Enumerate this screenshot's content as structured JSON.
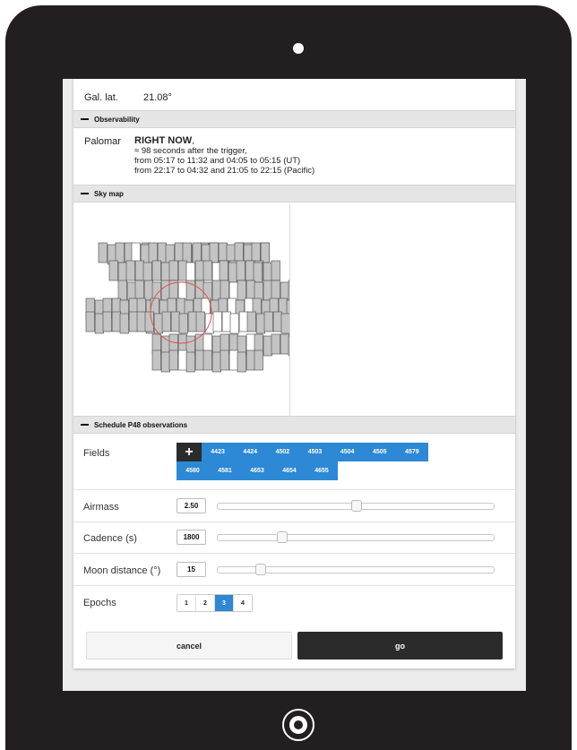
{
  "gal_lat": {
    "label": "Gal. lat.",
    "value": "21.08°"
  },
  "observability": {
    "title": "Observability",
    "site": "Palomar",
    "status": "RIGHT NOW",
    "status_suffix": ",",
    "lines": [
      "≈ 98 seconds after the trigger,",
      "from 05:17 to 11:32 and 04:05 to 05:15 (UT)",
      "from 22:17 to 04:32 and 21:05 to 22:15 (Pacific)"
    ]
  },
  "skymap": {
    "title": "Sky map"
  },
  "schedule": {
    "title": "Schedule P48 observations",
    "fields_label": "Fields",
    "add_symbol": "+",
    "fields": [
      "4423",
      "4424",
      "4502",
      "4503",
      "4504",
      "4505",
      "4579",
      "4580",
      "4581",
      "4653",
      "4654",
      "4655"
    ],
    "airmass_label": "Airmass",
    "airmass_value": "2.50",
    "airmass_fraction": 0.5,
    "cadence_label": "Cadence (s)",
    "cadence_value": "1800",
    "cadence_fraction": 0.22,
    "moon_label": "Moon distance (°)",
    "moon_value": "15",
    "moon_fraction": 0.14,
    "epochs_label": "Epochs",
    "epochs": [
      "1",
      "2",
      "3",
      "4"
    ],
    "epochs_selected": "3",
    "cancel_label": "cancel",
    "go_label": "go"
  },
  "colors": {
    "accent": "#2d88d5",
    "dark": "#2b2b2b",
    "device": "#231f20",
    "circle": "#d9534f"
  },
  "icons": {
    "collapse": "minus-icon",
    "add": "plus-icon"
  }
}
